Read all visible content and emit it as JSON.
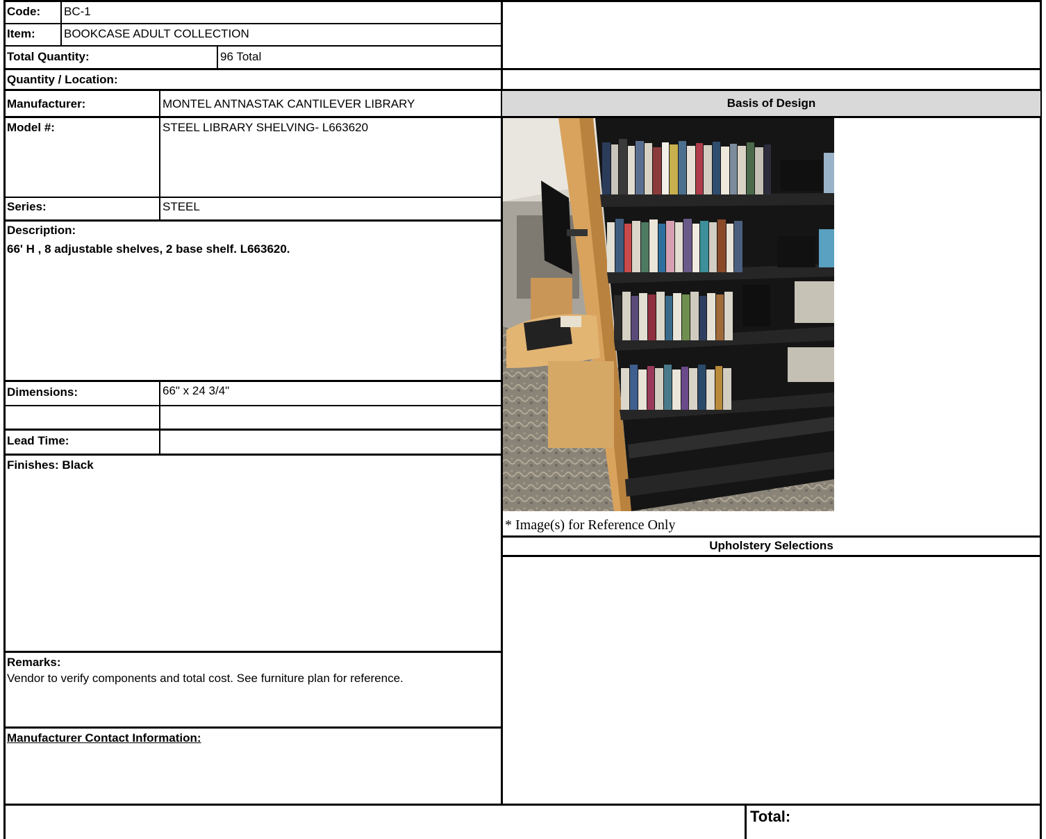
{
  "header": {
    "code_label": "Code:",
    "code_value": "BC-1",
    "item_label": "Item:",
    "item_value": "BOOKCASE ADULT COLLECTION",
    "total_qty_label": "Total Quantity:",
    "total_qty_value": "96 Total",
    "qty_location_label": "Quantity / Location:"
  },
  "details": {
    "manufacturer_label": "Manufacturer:",
    "manufacturer_value": "MONTEL ANTNASTAK CANTILEVER LIBRARY",
    "model_label": "Model #:",
    "model_value": "STEEL LIBRARY SHELVING- L663620",
    "series_label": "Series:",
    "series_value": "STEEL",
    "description_label": "Description:",
    "description_value": "66' H , 8 adjustable shelves, 2 base shelf. L663620.",
    "dimensions_label": "Dimensions:",
    "dimensions_value": "66\" x 24 3/4\"",
    "lead_time_label": "Lead Time:",
    "finishes_text": "Finishes: Black",
    "remarks_label": "Remarks:",
    "remarks_value": "Vendor to verify components and total cost. See furniture plan for reference.",
    "contact_label": "Manufacturer Contact Information:"
  },
  "right_panel": {
    "basis_title": "Basis of Design",
    "image_note": "* Image(s) for Reference Only",
    "upholstery_title": "Upholstery Selections"
  },
  "footer": {
    "total_label": "Total:"
  },
  "colors": {
    "header_fill": "#d9d9d9",
    "wood": "#d9a35e",
    "shelf": "#1c1c1c",
    "carpet": "#8a8478"
  }
}
